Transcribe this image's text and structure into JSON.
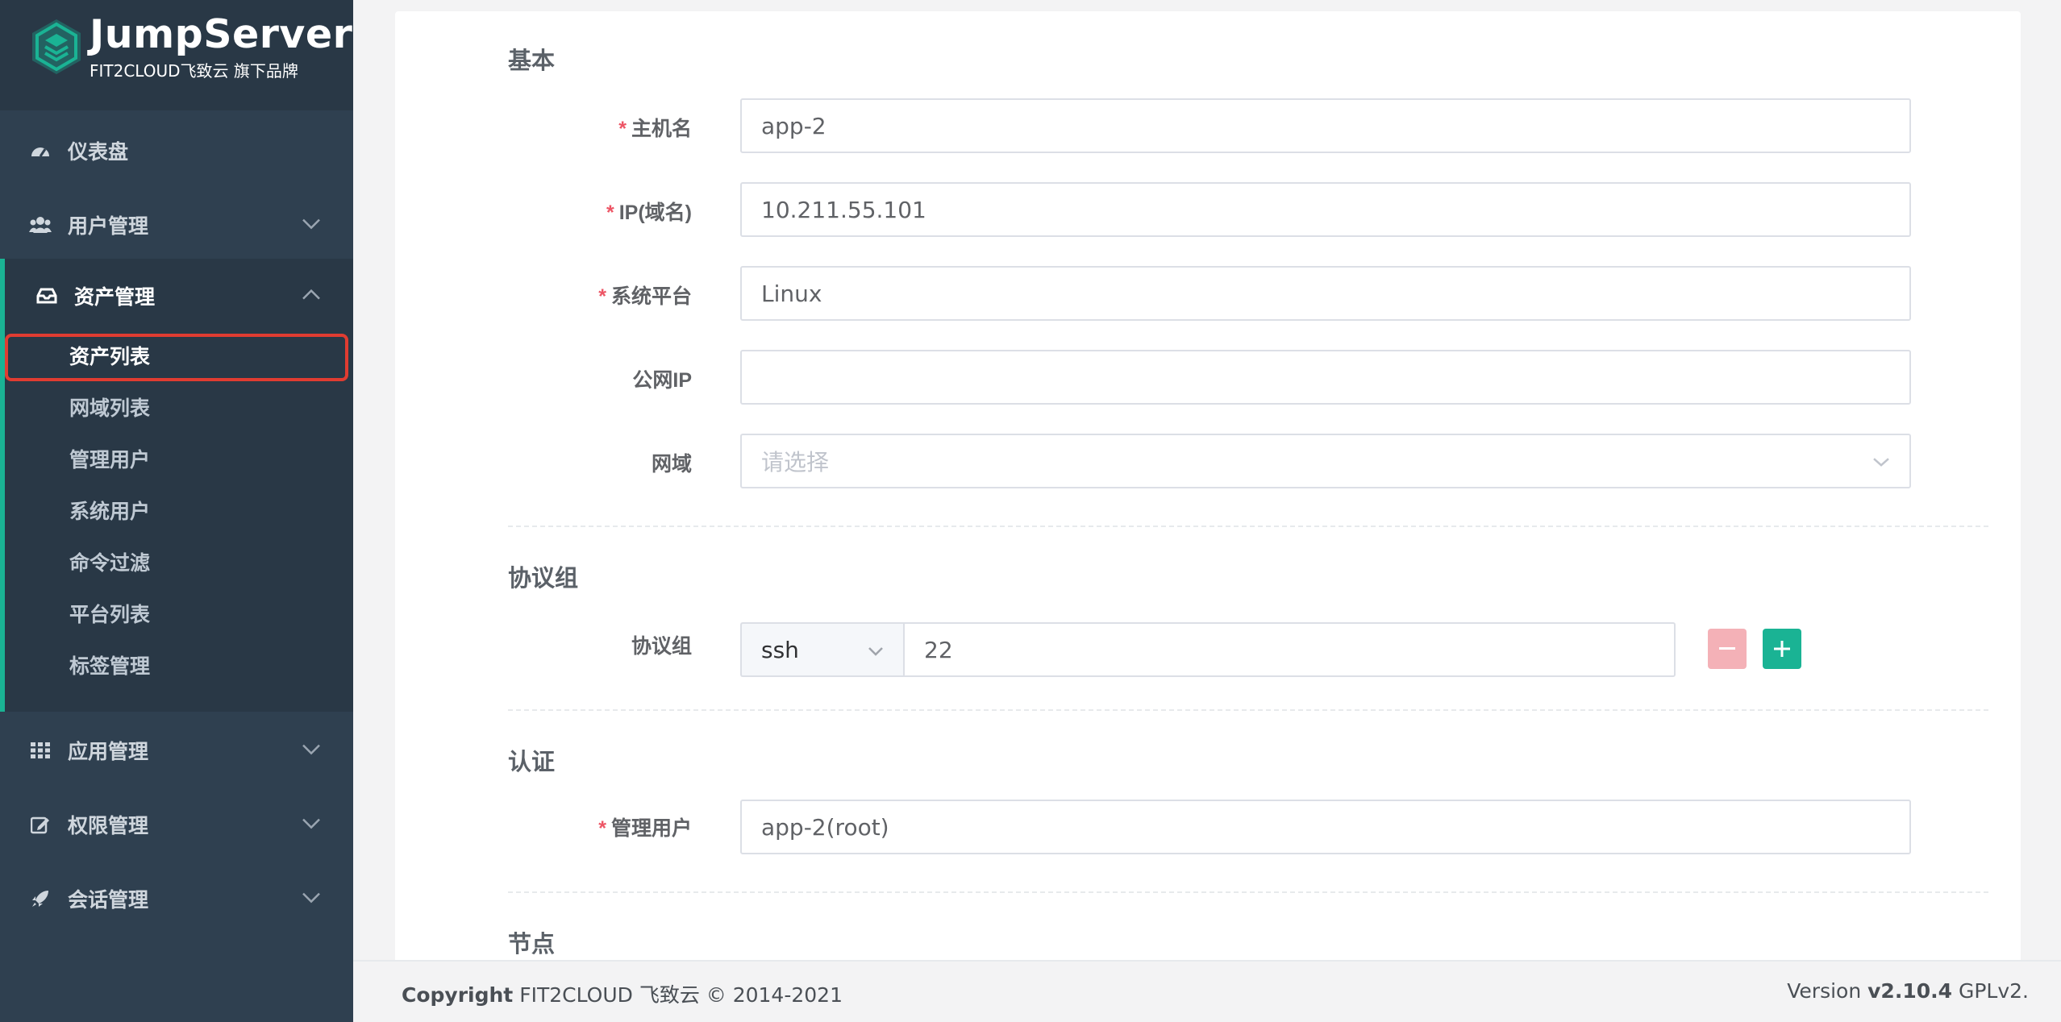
{
  "brand": {
    "title": "JumpServer",
    "subtitle": "FIT2CLOUD飞致云 旗下品牌"
  },
  "sidebar": {
    "menu": [
      {
        "label": "仪表盘",
        "icon": "dashboard-icon"
      },
      {
        "label": "用户管理",
        "icon": "users-icon"
      },
      {
        "label": "资产管理",
        "icon": "inbox-icon",
        "expanded": true
      },
      {
        "label": "应用管理",
        "icon": "grid-icon"
      },
      {
        "label": "权限管理",
        "icon": "edit-icon"
      },
      {
        "label": "会话管理",
        "icon": "rocket-icon"
      }
    ],
    "submenu": [
      {
        "label": "资产列表",
        "active": true
      },
      {
        "label": "网域列表"
      },
      {
        "label": "管理用户"
      },
      {
        "label": "系统用户"
      },
      {
        "label": "命令过滤"
      },
      {
        "label": "平台列表"
      },
      {
        "label": "标签管理"
      }
    ]
  },
  "form": {
    "sections": {
      "basic": "基本",
      "protocols": "协议组",
      "auth": "认证",
      "node": "节点"
    },
    "fields": {
      "hostname": {
        "label": "主机名",
        "value": "app-2",
        "required": true
      },
      "ip": {
        "label": "IP(域名)",
        "value": "10.211.55.101",
        "required": true
      },
      "platform": {
        "label": "系统平台",
        "value": "Linux",
        "required": true
      },
      "public_ip": {
        "label": "公网IP",
        "value": ""
      },
      "domain": {
        "label": "网域",
        "placeholder": "请选择"
      },
      "protocol": {
        "label": "协议组",
        "type": "ssh",
        "port": "22"
      },
      "admin_user": {
        "label": "管理用户",
        "value": "app-2(root)",
        "required": true
      }
    },
    "required_mark": "*"
  },
  "footer": {
    "copyright_bold": "Copyright",
    "copyright_text": "FIT2CLOUD 飞致云 © 2014-2021",
    "version_prefix": "Version",
    "version": "v2.10.4",
    "license": "GPLv2."
  },
  "colors": {
    "sidebar_bg": "#2f4050",
    "accent": "#1ab394",
    "danger": "#ed5565",
    "highlight": "#e03c31"
  }
}
